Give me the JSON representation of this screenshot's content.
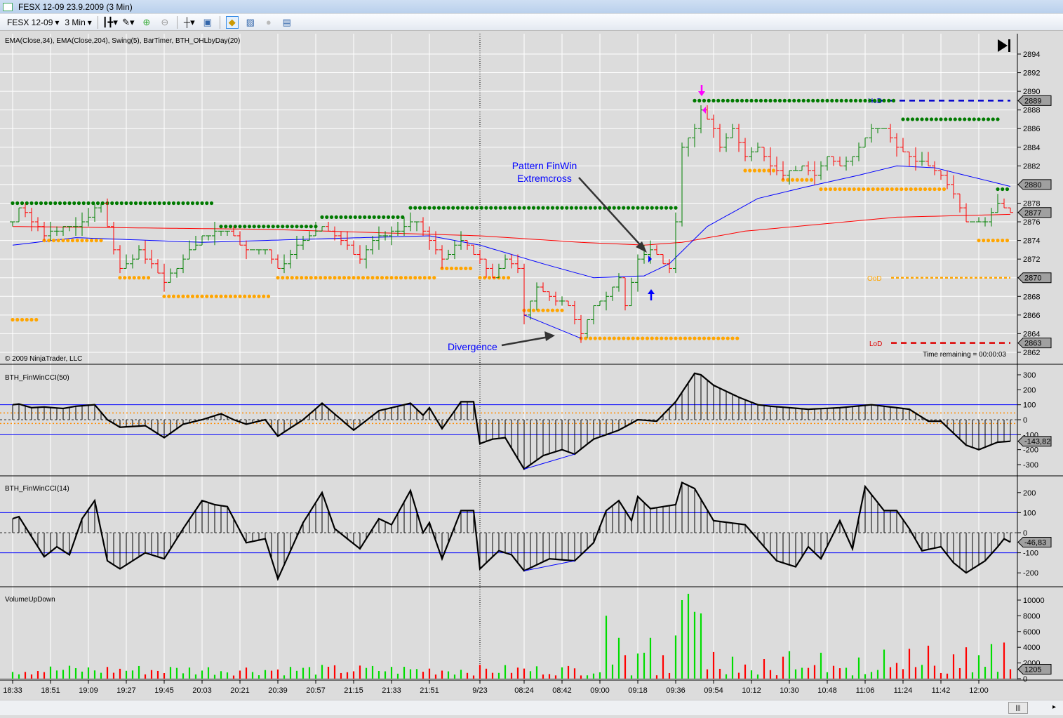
{
  "window": {
    "title": "FESX 12-09  23.9.2009 (3 Min)"
  },
  "toolbar": {
    "instrument": "FESX 12-09",
    "interval": "3 Min",
    "icons": [
      "bar-type-icon",
      "draw-pencil-icon",
      "zoom-in-icon",
      "zoom-out-icon",
      "crosshair-icon",
      "properties-icon",
      "strategy-icon",
      "indicators-icon",
      "coin-icon",
      "data-box-icon"
    ]
  },
  "price_panel": {
    "indicators_label": "EMA(Close,34), EMA(Close,204), Swing(5), BarTimer, BTH_OHLbyDay(20)",
    "copyright": "© 2009 NinjaTrader, LLC",
    "time_remaining": "Time remaining = 00:00:03",
    "ticks": [
      2862,
      2864,
      2866,
      2868,
      2870,
      2872,
      2874,
      2876,
      2878,
      2880,
      2882,
      2884,
      2886,
      2888,
      2890,
      2892,
      2894
    ],
    "markers": [
      {
        "v": 2889,
        "label": "2889"
      },
      {
        "v": 2880,
        "label": "2880"
      },
      {
        "v": 2877,
        "label": "2877"
      },
      {
        "v": 2870,
        "label": "2870"
      },
      {
        "v": 2863,
        "label": "2863"
      }
    ],
    "hod_label": "HoD",
    "ood_label": "OoD",
    "lod_label": "LoD",
    "hod": 2889,
    "ood": 2870,
    "lod": 2863,
    "annotation_pattern_1": "Pattern FinWin",
    "annotation_pattern_2": "Extremcross",
    "annotation_divergence": "Divergence"
  },
  "colors": {
    "up": "#008000",
    "down": "#ff0000",
    "ema34": "#0000ff",
    "ema204": "#ff0000",
    "swing_high": "#007a00",
    "swing_low": "#ffa500",
    "hod": "#0000cc",
    "lod": "#dd0000",
    "ood": "#ffa500",
    "vol_up": "#00dd00",
    "vol_down": "#ff0000"
  },
  "chart_data": {
    "type": "ohlc",
    "bar_count": 159,
    "close_keypoints": [
      [
        0,
        2876
      ],
      [
        1,
        2877.5
      ],
      [
        3,
        2876
      ],
      [
        5,
        2874.5
      ],
      [
        8,
        2875.5
      ],
      [
        11,
        2876
      ],
      [
        14,
        2878
      ],
      [
        16,
        2873
      ],
      [
        17,
        2871
      ],
      [
        20,
        2873
      ],
      [
        24,
        2869.5
      ],
      [
        27,
        2872
      ],
      [
        30,
        2874.5
      ],
      [
        34,
        2875
      ],
      [
        37,
        2873
      ],
      [
        40,
        2873
      ],
      [
        42,
        2871
      ],
      [
        46,
        2874
      ],
      [
        49,
        2875.5
      ],
      [
        52,
        2874
      ],
      [
        55,
        2872
      ],
      [
        57,
        2874
      ],
      [
        60,
        2875
      ],
      [
        64,
        2876
      ],
      [
        66,
        2874
      ],
      [
        68,
        2872
      ],
      [
        71,
        2874
      ],
      [
        74,
        2872
      ],
      [
        76,
        2870
      ],
      [
        78,
        2872
      ],
      [
        80,
        2871
      ],
      [
        81,
        2866
      ],
      [
        83,
        2869
      ],
      [
        86,
        2867.5
      ],
      [
        88,
        2867
      ],
      [
        90,
        2864
      ],
      [
        92,
        2867
      ],
      [
        94,
        2868
      ],
      [
        96,
        2870
      ],
      [
        97,
        2867
      ],
      [
        99,
        2872
      ],
      [
        101,
        2873
      ],
      [
        104,
        2871
      ],
      [
        105,
        2876
      ],
      [
        106,
        2884
      ],
      [
        108,
        2886
      ],
      [
        109,
        2888
      ],
      [
        111,
        2886
      ],
      [
        112,
        2884
      ],
      [
        114,
        2886
      ],
      [
        116,
        2883
      ],
      [
        118,
        2884
      ],
      [
        120,
        2882
      ],
      [
        122,
        2881
      ],
      [
        125,
        2882
      ],
      [
        127,
        2881
      ],
      [
        129,
        2883
      ],
      [
        131,
        2882
      ],
      [
        134,
        2884
      ],
      [
        136,
        2886
      ],
      [
        138,
        2886
      ],
      [
        140,
        2884
      ],
      [
        142,
        2883
      ],
      [
        145,
        2882
      ],
      [
        147,
        2881
      ],
      [
        149,
        2879
      ],
      [
        151,
        2876
      ],
      [
        154,
        2876
      ],
      [
        156,
        2878
      ],
      [
        158,
        2877
      ]
    ],
    "ema34_keypoints": [
      [
        0,
        2873.5
      ],
      [
        10,
        2874.3
      ],
      [
        30,
        2873.8
      ],
      [
        50,
        2874.2
      ],
      [
        66,
        2874.5
      ],
      [
        74,
        2873.5
      ],
      [
        84,
        2871.5
      ],
      [
        92,
        2870
      ],
      [
        100,
        2870.2
      ],
      [
        104,
        2871.5
      ],
      [
        110,
        2875.5
      ],
      [
        118,
        2878.5
      ],
      [
        126,
        2879.8
      ],
      [
        134,
        2881
      ],
      [
        140,
        2882
      ],
      [
        146,
        2881.8
      ],
      [
        158,
        2879.8
      ]
    ],
    "ema204_keypoints": [
      [
        0,
        2875.5
      ],
      [
        40,
        2875.2
      ],
      [
        74,
        2874.5
      ],
      [
        90,
        2873.8
      ],
      [
        100,
        2873.5
      ],
      [
        106,
        2873.8
      ],
      [
        116,
        2875
      ],
      [
        140,
        2876.5
      ],
      [
        158,
        2876.8
      ]
    ],
    "swing_highs": [
      [
        0,
        32,
        2878
      ],
      [
        33,
        48,
        2875.5
      ],
      [
        49,
        62,
        2876.5
      ],
      [
        63,
        105,
        2877.5
      ],
      [
        108,
        140,
        2889
      ],
      [
        141,
        156,
        2887
      ],
      [
        156,
        158,
        2879.5
      ]
    ],
    "swing_lows": [
      [
        0,
        4,
        2865.5
      ],
      [
        5,
        14,
        2874
      ],
      [
        17,
        22,
        2870
      ],
      [
        24,
        41,
        2868
      ],
      [
        42,
        67,
        2870
      ],
      [
        68,
        73,
        2871
      ],
      [
        74,
        79,
        2870
      ],
      [
        81,
        87,
        2866.5
      ],
      [
        90,
        115,
        2863.5
      ],
      [
        116,
        121,
        2881.5
      ],
      [
        122,
        127,
        2880.5
      ],
      [
        128,
        148,
        2879.5
      ],
      [
        153,
        158,
        2874
      ]
    ],
    "time_labels": [
      [
        0,
        "18:33"
      ],
      [
        6,
        "18:51"
      ],
      [
        12,
        "19:09"
      ],
      [
        18,
        "19:27"
      ],
      [
        24,
        "19:45"
      ],
      [
        30,
        "20:03"
      ],
      [
        36,
        "20:21"
      ],
      [
        42,
        "20:39"
      ],
      [
        48,
        "20:57"
      ],
      [
        54,
        "21:15"
      ],
      [
        60,
        "21:33"
      ],
      [
        66,
        "21:51"
      ],
      [
        74,
        "9/23"
      ],
      [
        81,
        "08:24"
      ],
      [
        87,
        "08:42"
      ],
      [
        93,
        "09:00"
      ],
      [
        99,
        "09:18"
      ],
      [
        105,
        "09:36"
      ],
      [
        111,
        "09:54"
      ],
      [
        117,
        "10:12"
      ],
      [
        123,
        "10:30"
      ],
      [
        129,
        "10:48"
      ],
      [
        135,
        "11:06"
      ],
      [
        141,
        "11:24"
      ],
      [
        147,
        "11:42"
      ],
      [
        153,
        "12:00"
      ]
    ],
    "session_break_bar": 74,
    "cci50": {
      "title": "BTH_FinWinCCI(50)",
      "ticks": [
        -300,
        -200,
        -100,
        0,
        100,
        200,
        300
      ],
      "last": "-143,82",
      "keypoints": [
        [
          0,
          100
        ],
        [
          1,
          105
        ],
        [
          3,
          80
        ],
        [
          5,
          85
        ],
        [
          8,
          75
        ],
        [
          10,
          90
        ],
        [
          13,
          100
        ],
        [
          15,
          0
        ],
        [
          17,
          -50
        ],
        [
          21,
          -40
        ],
        [
          24,
          -120
        ],
        [
          27,
          -30
        ],
        [
          30,
          0
        ],
        [
          33,
          40
        ],
        [
          35,
          0
        ],
        [
          37,
          -30
        ],
        [
          40,
          0
        ],
        [
          42,
          -110
        ],
        [
          46,
          0
        ],
        [
          49,
          110
        ],
        [
          54,
          -70
        ],
        [
          58,
          60
        ],
        [
          63,
          110
        ],
        [
          65,
          30
        ],
        [
          66,
          80
        ],
        [
          68,
          -60
        ],
        [
          71,
          120
        ],
        [
          73,
          120
        ],
        [
          74,
          -160
        ],
        [
          76,
          -130
        ],
        [
          78,
          -120
        ],
        [
          81,
          -330
        ],
        [
          84,
          -240
        ],
        [
          87,
          -200
        ],
        [
          89,
          -230
        ],
        [
          92,
          -130
        ],
        [
          96,
          -70
        ],
        [
          99,
          0
        ],
        [
          102,
          -10
        ],
        [
          105,
          120
        ],
        [
          108,
          310
        ],
        [
          109,
          300
        ],
        [
          111,
          230
        ],
        [
          115,
          150
        ],
        [
          118,
          100
        ],
        [
          120,
          90
        ],
        [
          126,
          70
        ],
        [
          131,
          80
        ],
        [
          136,
          100
        ],
        [
          140,
          80
        ],
        [
          142,
          70
        ],
        [
          145,
          -10
        ],
        [
          147,
          -10
        ],
        [
          151,
          -170
        ],
        [
          153,
          -200
        ],
        [
          156,
          -150
        ],
        [
          158,
          -144
        ]
      ]
    },
    "cci14": {
      "title": "BTH_FinWinCCI(14)",
      "ticks": [
        -200,
        -100,
        0,
        100,
        200
      ],
      "last": "-46,83",
      "keypoints": [
        [
          0,
          70
        ],
        [
          1,
          80
        ],
        [
          3,
          -20
        ],
        [
          5,
          -120
        ],
        [
          7,
          -70
        ],
        [
          9,
          -110
        ],
        [
          11,
          70
        ],
        [
          13,
          160
        ],
        [
          15,
          -140
        ],
        [
          17,
          -180
        ],
        [
          21,
          -100
        ],
        [
          24,
          -130
        ],
        [
          27,
          20
        ],
        [
          30,
          160
        ],
        [
          32,
          140
        ],
        [
          34,
          130
        ],
        [
          37,
          -50
        ],
        [
          40,
          -30
        ],
        [
          42,
          -230
        ],
        [
          46,
          50
        ],
        [
          49,
          200
        ],
        [
          51,
          20
        ],
        [
          55,
          -80
        ],
        [
          58,
          70
        ],
        [
          60,
          40
        ],
        [
          63,
          210
        ],
        [
          65,
          0
        ],
        [
          66,
          50
        ],
        [
          68,
          -130
        ],
        [
          71,
          110
        ],
        [
          73,
          110
        ],
        [
          74,
          -180
        ],
        [
          77,
          -90
        ],
        [
          79,
          -110
        ],
        [
          81,
          -190
        ],
        [
          85,
          -130
        ],
        [
          89,
          -140
        ],
        [
          92,
          -50
        ],
        [
          94,
          110
        ],
        [
          96,
          160
        ],
        [
          98,
          60
        ],
        [
          99,
          180
        ],
        [
          101,
          120
        ],
        [
          105,
          140
        ],
        [
          106,
          250
        ],
        [
          108,
          220
        ],
        [
          111,
          60
        ],
        [
          116,
          40
        ],
        [
          119,
          -70
        ],
        [
          121,
          -140
        ],
        [
          124,
          -170
        ],
        [
          126,
          -70
        ],
        [
          128,
          -130
        ],
        [
          131,
          60
        ],
        [
          133,
          -80
        ],
        [
          135,
          230
        ],
        [
          138,
          110
        ],
        [
          140,
          110
        ],
        [
          142,
          20
        ],
        [
          144,
          -90
        ],
        [
          147,
          -70
        ],
        [
          149,
          -150
        ],
        [
          151,
          -200
        ],
        [
          154,
          -140
        ],
        [
          156,
          -70
        ],
        [
          157,
          -30
        ],
        [
          158,
          -47
        ]
      ]
    },
    "volume": {
      "title": "VolumeUpDown",
      "ticks": [
        0,
        2000,
        4000,
        6000,
        8000,
        10000
      ],
      "last": "1205",
      "spikes": [
        [
          94,
          8000
        ],
        [
          96,
          5200
        ],
        [
          97,
          3000
        ],
        [
          99,
          3200
        ],
        [
          100,
          3300
        ],
        [
          101,
          5200
        ],
        [
          103,
          3000
        ],
        [
          105,
          5500
        ],
        [
          106,
          10000
        ],
        [
          107,
          10800
        ],
        [
          108,
          8500
        ],
        [
          109,
          8300
        ],
        [
          111,
          3400
        ],
        [
          114,
          2800
        ],
        [
          116,
          1800
        ],
        [
          119,
          2500
        ],
        [
          122,
          2800
        ],
        [
          123,
          3500
        ],
        [
          128,
          3300
        ],
        [
          134,
          2700
        ],
        [
          138,
          3700
        ],
        [
          140,
          2000
        ],
        [
          142,
          3800
        ],
        [
          145,
          4200
        ],
        [
          149,
          3100
        ],
        [
          151,
          4000
        ],
        [
          153,
          3000
        ],
        [
          155,
          4400
        ],
        [
          157,
          4600
        ],
        [
          158,
          1205
        ]
      ]
    },
    "divergence": {
      "price": [
        [
          81,
          2866
        ],
        [
          90,
          2863.5
        ]
      ],
      "cci50": [
        [
          81,
          -330
        ],
        [
          89,
          -230
        ]
      ],
      "cci14": [
        [
          81,
          -190
        ],
        [
          89,
          -140
        ]
      ]
    }
  }
}
